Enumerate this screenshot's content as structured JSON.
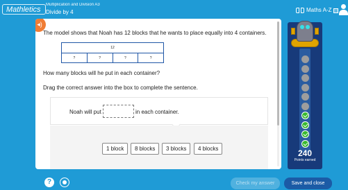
{
  "header": {
    "brand": "Mathletics",
    "breadcrumb": "Multiplication and Division A3",
    "title": "Divide by 4",
    "maths_az": "Maths A-Z"
  },
  "question": {
    "text": "The model shows that Noah has 12 blocks that he wants to place equally into 4 containers.",
    "model_total": "12",
    "model_parts": [
      "?",
      "?",
      "?",
      "?"
    ],
    "prompt": "How many blocks will he put in each container?",
    "instruction": "Drag the correct answer into the box to complete the sentence."
  },
  "answer": {
    "pre": "Noah will put",
    "post": "in each container."
  },
  "choices": [
    "1 block",
    "8 blocks",
    "3 blocks",
    "4 blocks"
  ],
  "progress": {
    "total": 10,
    "completed": 4,
    "points": "240",
    "points_label": "Points earned"
  },
  "footer": {
    "help": "?",
    "check": "Check my answer",
    "save": "Save and close"
  },
  "colors": {
    "background": "#1f9bd6",
    "tower": "#173a7a",
    "done": "#38b92f",
    "speaker": "#f07d35",
    "save": "#1b5ba6"
  }
}
